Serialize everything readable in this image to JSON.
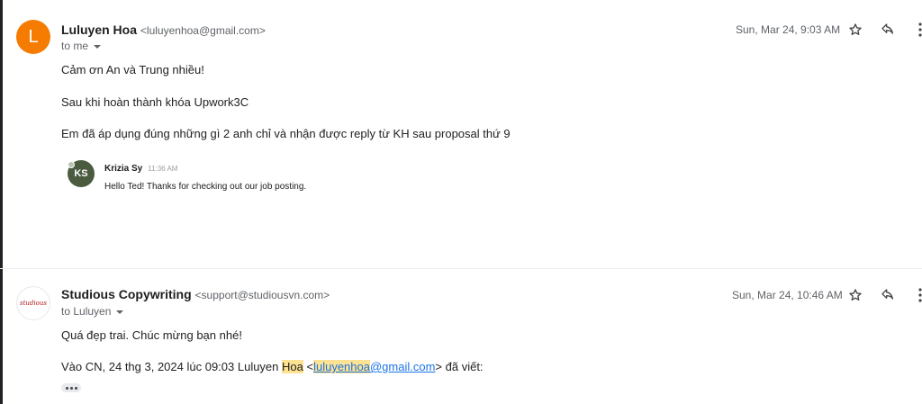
{
  "messages": [
    {
      "avatar_letter": "L",
      "sender_name": "Luluyen Hoa",
      "sender_email": "<luluyenhoa@gmail.com>",
      "recipient": "to me",
      "date": "Sun, Mar 24, 9:03 AM",
      "body": [
        "Cảm ơn An và Trung nhiều!",
        "Sau khi hoàn thành khóa Upwork3C",
        "Em đã áp dụng đúng những gì 2 anh chỉ và nhận được reply từ KH sau proposal thứ 9"
      ],
      "quoted": {
        "avatar_initials": "KS",
        "name": "Krizia Sy",
        "time": "11:36 AM",
        "text": "Hello Ted! Thanks for checking out our job posting."
      }
    },
    {
      "avatar_logo_text": "studious",
      "sender_name": "Studious Copywriting",
      "sender_email": "<support@studiousvn.com>",
      "recipient": "to Luluyen",
      "date": "Sun, Mar 24, 10:46 AM",
      "body": [
        "Quá đẹp trai. Chúc mừng bạn nhé!"
      ],
      "quote_header": {
        "prefix": "Vào CN, 24 thg 3, 2024 lúc 09:03 Luluyen ",
        "highlight": "Hoa",
        "lt": " <",
        "email_highlight": "luluyenhoa",
        "email_rest": "@gmail.com",
        "suffix": "> đã viết:"
      }
    }
  ],
  "icons": {
    "star": "star-icon",
    "reply": "reply-icon",
    "more": "more-vert-icon",
    "caret": "caret-down-icon"
  },
  "colors": {
    "avatar_orange": "#f57c00",
    "highlight": "#fde293",
    "link": "#1a73e8"
  }
}
